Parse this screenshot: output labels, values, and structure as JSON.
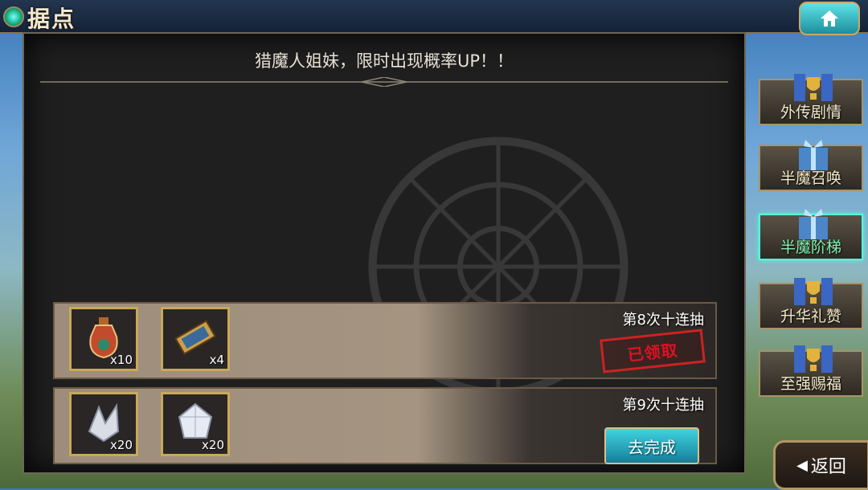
{
  "header": {
    "title": "据点",
    "home_icon": "home-icon"
  },
  "panel": {
    "title": "猎魔人姐妹，限时出现概率UP！！",
    "rows": [
      {
        "title": "第8次十连抽",
        "status": "已领取",
        "items": [
          {
            "icon": "potion-icon",
            "qty": "x10"
          },
          {
            "icon": "ticket-icon",
            "qty": "x4"
          }
        ]
      },
      {
        "title": "第9次十连抽",
        "action": "去完成",
        "items": [
          {
            "icon": "crystal-shard-icon",
            "qty": "x20"
          },
          {
            "icon": "crystal-gem-icon",
            "qty": "x20"
          }
        ]
      }
    ]
  },
  "side_menu": [
    {
      "label": "外传剧情",
      "icon": "banner-trophy-icon",
      "active": false
    },
    {
      "label": "半魔召唤",
      "icon": "gift-box-icon",
      "active": false
    },
    {
      "label": "半魔阶梯",
      "icon": "gift-box-icon",
      "active": true
    },
    {
      "label": "升华礼赞",
      "icon": "banner-trophy-icon",
      "active": false
    },
    {
      "label": "至强赐福",
      "icon": "banner-trophy-icon",
      "active": false
    }
  ],
  "back_button": {
    "label": "返回",
    "icon": "back-arrow-icon"
  },
  "colors": {
    "accent": "#1fb3c4",
    "frame": "#c8a85a",
    "stamp": "#cc2222"
  }
}
